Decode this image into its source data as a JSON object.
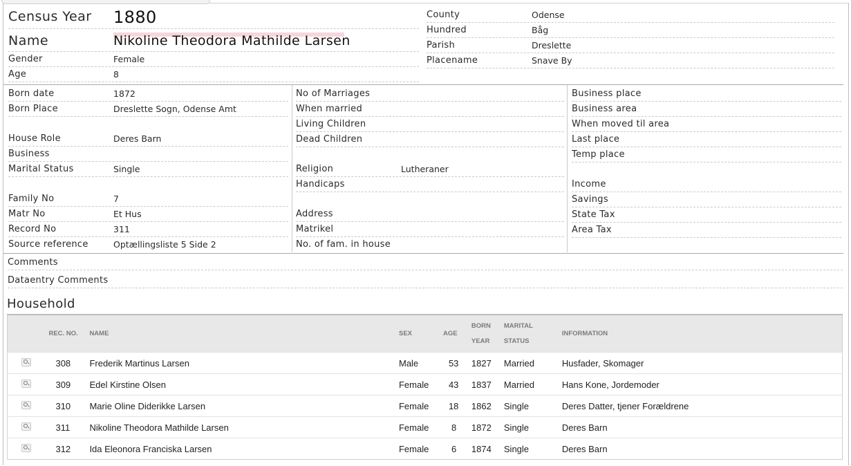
{
  "header": {
    "census_year_label": "Census Year",
    "census_year": "1880",
    "name_label": "Name",
    "name": "Nikoline Theodora Mathilde Larsen",
    "gender_label": "Gender",
    "gender": "Female",
    "age_label": "Age",
    "age": "8",
    "county_label": "County",
    "county": "Odense",
    "hundred_label": "Hundred",
    "hundred": "Båg",
    "parish_label": "Parish",
    "parish": "Dreslette",
    "placename_label": "Placename",
    "placename": "Snave By"
  },
  "col1": {
    "born_date_label": "Born date",
    "born_date": "1872",
    "born_place_label": "Born Place",
    "born_place": "Dreslette Sogn, Odense Amt",
    "house_role_label": "House Role",
    "house_role": "Deres Barn",
    "business_label": "Business",
    "marital_status_label": "Marital Status",
    "marital_status": "Single",
    "family_no_label": "Family No",
    "family_no": "7",
    "matr_no_label": "Matr No",
    "matr_no": "Et Hus",
    "record_no_label": "Record No",
    "record_no": "311",
    "source_reference_label": "Source reference",
    "source_reference": "Optællingsliste 5 Side 2"
  },
  "col2": {
    "no_of_marriages_label": "No of Marriages",
    "when_married_label": "When married",
    "living_children_label": "Living Children",
    "dead_children_label": "Dead Children",
    "religion_label": "Religion",
    "religion": "Lutheraner",
    "handicaps_label": "Handicaps",
    "address_label": "Address",
    "matrikel_label": "Matrikel",
    "fam_in_house_label": "No. of fam. in house"
  },
  "col3": {
    "business_place_label": "Business place",
    "business_area_label": "Business area",
    "when_moved_label": "When moved til area",
    "last_place_label": "Last place",
    "temp_place_label": "Temp place",
    "income_label": "Income",
    "savings_label": "Savings",
    "state_tax_label": "State Tax",
    "area_tax_label": "Area Tax"
  },
  "comments_label": "Comments",
  "dataentry_comments_label": "Dataentry Comments",
  "household": {
    "title": "Household",
    "columns": {
      "rec_no": "REC. NO.",
      "name": "NAME",
      "sex": "SEX",
      "age": "AGE",
      "born_year_1": "BORN",
      "born_year_2": "YEAR",
      "marital_1": "MARITAL",
      "marital_2": "STATUS",
      "information": "INFORMATION"
    },
    "rows": [
      {
        "rec_no": "308",
        "name": "Frederik Martinus Larsen",
        "sex": "Male",
        "age": "53",
        "born_year": "1827",
        "marital": "Married",
        "information": "Husfader, Skomager"
      },
      {
        "rec_no": "309",
        "name": "Edel Kirstine Olsen",
        "sex": "Female",
        "age": "43",
        "born_year": "1837",
        "marital": "Married",
        "information": "Hans Kone, Jordemoder"
      },
      {
        "rec_no": "310",
        "name": "Marie Oline Diderikke Larsen",
        "sex": "Female",
        "age": "18",
        "born_year": "1862",
        "marital": "Single",
        "information": "Deres Datter, tjener Forældrene"
      },
      {
        "rec_no": "311",
        "name": "Nikoline Theodora Mathilde Larsen",
        "sex": "Female",
        "age": "8",
        "born_year": "1872",
        "marital": "Single",
        "information": "Deres Barn"
      },
      {
        "rec_no": "312",
        "name": "Ida Eleonora Franciska Larsen",
        "sex": "Female",
        "age": "6",
        "born_year": "1874",
        "marital": "Single",
        "information": "Deres Barn"
      }
    ]
  }
}
